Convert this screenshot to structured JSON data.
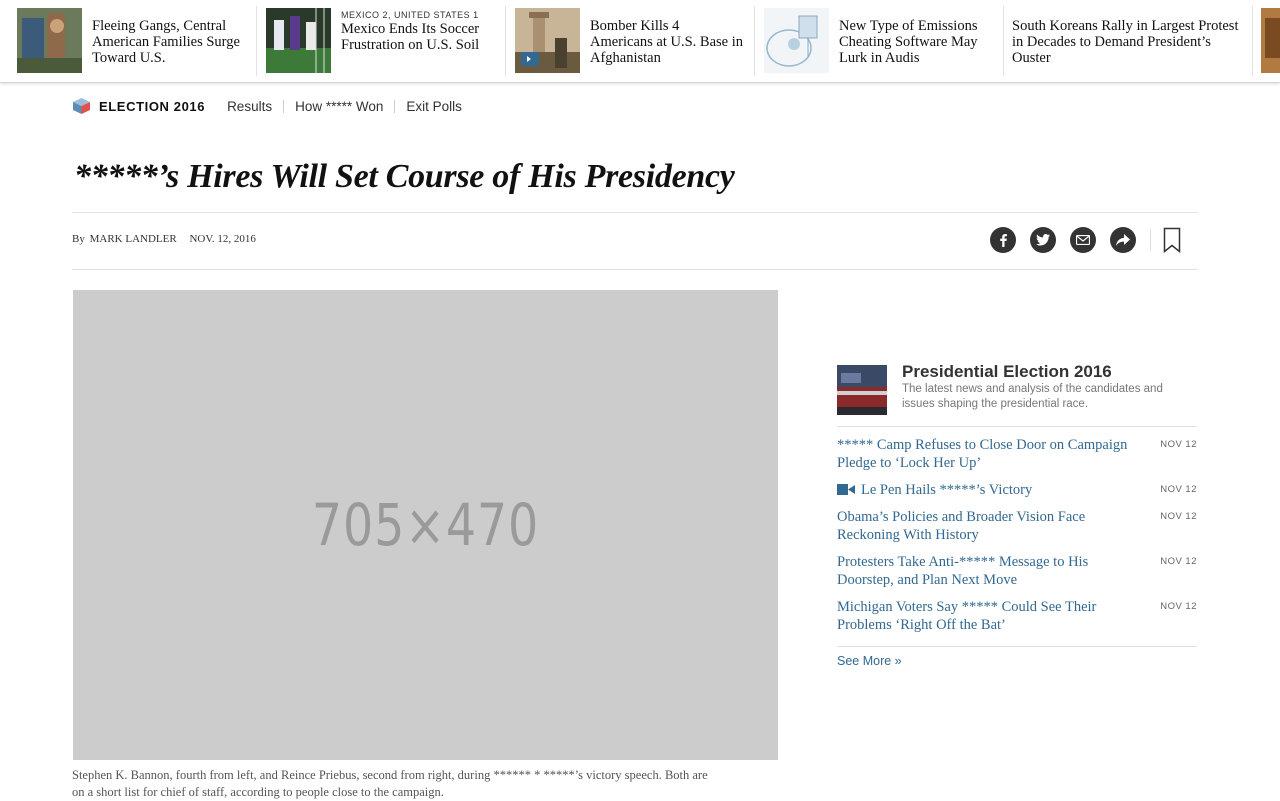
{
  "ribbon": {
    "items": [
      {
        "kicker": "",
        "headline": "Fleeing Gangs, Central American Families Surge Toward U.S."
      },
      {
        "kicker": "MEXICO 2, UNITED STATES 1",
        "headline": "Mexico Ends Its Soccer Frustration on U.S. Soil"
      },
      {
        "kicker": "",
        "headline": "Bomber Kills 4 Americans at U.S. Base in Afghanistan"
      },
      {
        "kicker": "",
        "headline": "New Type of Emissions Cheating Software May Lurk in Audis"
      },
      {
        "kicker": "",
        "headline": "South Koreans Rally in Largest Protest in Decades to Demand President’s Ouster"
      }
    ]
  },
  "section_nav": {
    "title": "ELECTION 2016",
    "links": [
      "Results",
      "How ***** Won",
      "Exit Polls"
    ]
  },
  "article": {
    "headline": "*****’s Hires Will Set Course of His Presidency",
    "byline_prefix": "By",
    "author": "MARK LANDLER",
    "date": "NOV. 12, 2016",
    "image_placeholder": "705×470",
    "caption": "Stephen K. Bannon, fourth from left, and Reince Priebus, second from right, during ****** * *****’s victory speech. Both are on a short list for chief of staff, according to people close to the campaign."
  },
  "share": {
    "icons": [
      "facebook-icon",
      "twitter-icon",
      "email-icon",
      "share-icon",
      "bookmark-icon"
    ]
  },
  "sidebar": {
    "title": "Presidential Election 2016",
    "subtitle": "The latest news and analysis of the candidates and issues shaping the presidential race.",
    "items": [
      {
        "text": "***** Camp Refuses to Close Door on Campaign Pledge to ‘Lock Her Up’",
        "date": "NOV 12",
        "video": false
      },
      {
        "text": "Le Pen Hails *****’s Victory",
        "date": "NOV 12",
        "video": true
      },
      {
        "text": "Obama’s Policies and Broader Vision Face Reckoning With History",
        "date": "NOV 12",
        "video": false
      },
      {
        "text": "Protesters Take Anti-***** Message to His Doorstep, and Plan Next Move",
        "date": "NOV 12",
        "video": false
      },
      {
        "text": "Michigan Voters Say ***** Could See Their Problems ‘Right Off the Bat’",
        "date": "NOV 12",
        "video": false
      }
    ],
    "see_more": "See More »"
  },
  "colors": {
    "link": "#326891",
    "share_icon_bg": "#333333",
    "image_placeholder_bg": "#cccccc"
  }
}
